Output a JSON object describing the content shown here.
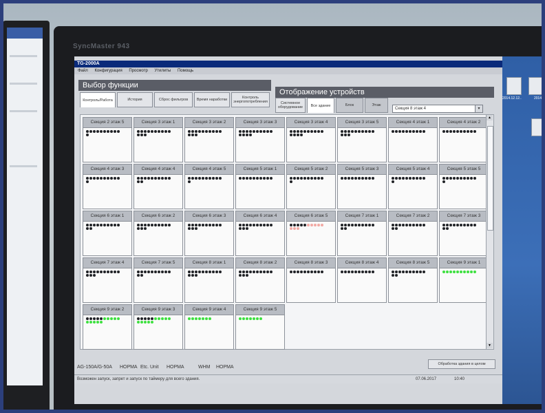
{
  "photo": {
    "brand": "SyncMaster 943"
  },
  "app": {
    "title": "TG-2000A",
    "menu": [
      "Файл",
      "Конфигурация",
      "Просмотр",
      "Утилиты",
      "Помощь"
    ],
    "function_panel": {
      "heading": "Выбор функции",
      "buttons": [
        "Контроль/Работа",
        "История",
        "Сброс фильтров",
        "Время наработки",
        "Контроль энергопотребления"
      ]
    },
    "device_panel": {
      "heading": "Отображение устройств",
      "buttons": [
        "Системное оборудование",
        "Все здание",
        "Блок",
        "Этаж"
      ],
      "combo_value": "Секция 8 этаж 4"
    },
    "cells": [
      {
        "label": "Секция 2 этаж 5",
        "dots": "kkkkkkkkkk k"
      },
      {
        "label": "Секция 3 этаж 1",
        "dots": "kkkkkkkkkk kkk"
      },
      {
        "label": "Секция 3 этаж 2",
        "dots": "kkkkkkkkkk kkk"
      },
      {
        "label": "Секция 3 этаж 3",
        "dots": "kkkkkkkkkk kkkk"
      },
      {
        "label": "Секция 3 этаж 4",
        "dots": "kkkkkkkkkk kkkk"
      },
      {
        "label": "Секция 3 этаж 5",
        "dots": "kkkkkkkkkk kkk"
      },
      {
        "label": "Секция 4 этаж 1",
        "dots": "kkkkkkkkkk"
      },
      {
        "label": "Секция 4 этаж 2",
        "dots": "kkkkkkkkkk"
      },
      {
        "label": "Секция 4 этаж 3",
        "dots": "kkkkkkkkkk k"
      },
      {
        "label": "Секция 4 этаж 4",
        "dots": "kkkkkkkkkk kk"
      },
      {
        "label": "Секция 4 этаж 5",
        "dots": "kkkkkkkkkk k"
      },
      {
        "label": "Секция 5 этаж 1",
        "dots": "kkkkkkkkkk"
      },
      {
        "label": "Секция 5 этаж 2",
        "dots": "kkkkkkkkkk k"
      },
      {
        "label": "Секция 5 этаж 3",
        "dots": "kkkkkkkkkk"
      },
      {
        "label": "Секция 5 этаж 4",
        "dots": "kkkkkkkkkk k"
      },
      {
        "label": "Секция 5 этаж 5",
        "dots": "kkkkkkkkkk k"
      },
      {
        "label": "Секция 6 этаж 1",
        "dots": "kkkkkkkkkk kk"
      },
      {
        "label": "Секция 6 этаж 2",
        "dots": "kkkkkkkkkk kkk"
      },
      {
        "label": "Секция 6 этаж 3",
        "dots": "kkkkkkkkkk kkk"
      },
      {
        "label": "Секция 6 этаж 4",
        "dots": "kkkkkkkkkk kkk"
      },
      {
        "label": "Секция 6 этаж 5",
        "dots": "kkkkkrrrrr rrr"
      },
      {
        "label": "Секция 7 этаж 1",
        "dots": "kkkkkkkkkk kk"
      },
      {
        "label": "Секция 7 этаж 2",
        "dots": "kkkkkkkkkk kk"
      },
      {
        "label": "Секция 7 этаж 3",
        "dots": "kkkkkkkkkk kk"
      },
      {
        "label": "Секция 7 этаж 4",
        "dots": "kkkkkkkkkk kkk"
      },
      {
        "label": "Секция 7 этаж 5",
        "dots": "kkkkkkkkkk kk"
      },
      {
        "label": "Секция 8 этаж 1",
        "dots": "kkkkkkkkkk kkk"
      },
      {
        "label": "Секция 8 этаж 2",
        "dots": "kkkkkkkkkk kkk"
      },
      {
        "label": "Секция 8 этаж 3",
        "dots": "kkkkkkkkkk"
      },
      {
        "label": "Секция 8 этаж 4",
        "dots": "kkkkkkkkkk"
      },
      {
        "label": "Секция 8 этаж 5",
        "dots": "kkkkkkkkkk kk"
      },
      {
        "label": "Секция 9 этаж 1",
        "dots": "gggggggggg"
      },
      {
        "label": "Секция 9 этаж 2",
        "dots": "kkkkkggggg ggggg"
      },
      {
        "label": "Секция 9 этаж 3",
        "dots": "kkkkkggggg ggggg"
      },
      {
        "label": "Секция 9 этаж 4",
        "dots": "ggggggg"
      },
      {
        "label": "Секция 9 этаж 5",
        "dots": "ggggggg"
      }
    ],
    "status": {
      "ag": "AG-150A/G-50A",
      "ag_state": "НОРМА",
      "etc": "Etc. Unit",
      "etc_state": "НОРМА",
      "whm": "WHM",
      "whm_state": "НОРМА"
    },
    "process_button": "Обработка здания в целом",
    "bottom": {
      "hint": "Возможен запуск, запрет и запуск по таймеру для всего здания.",
      "date": "07.06.2017",
      "time": "10:40"
    },
    "desktop_icons": [
      "2014.12.12..",
      "2014"
    ]
  },
  "colors": {
    "title_blue": "#0a2a7a",
    "panel_gray": "#5a5d66",
    "unit_black": "#202226",
    "unit_green": "#3de03f",
    "unit_pink": "#f2a9a4",
    "desktop_blue": "#2f5fa6"
  }
}
